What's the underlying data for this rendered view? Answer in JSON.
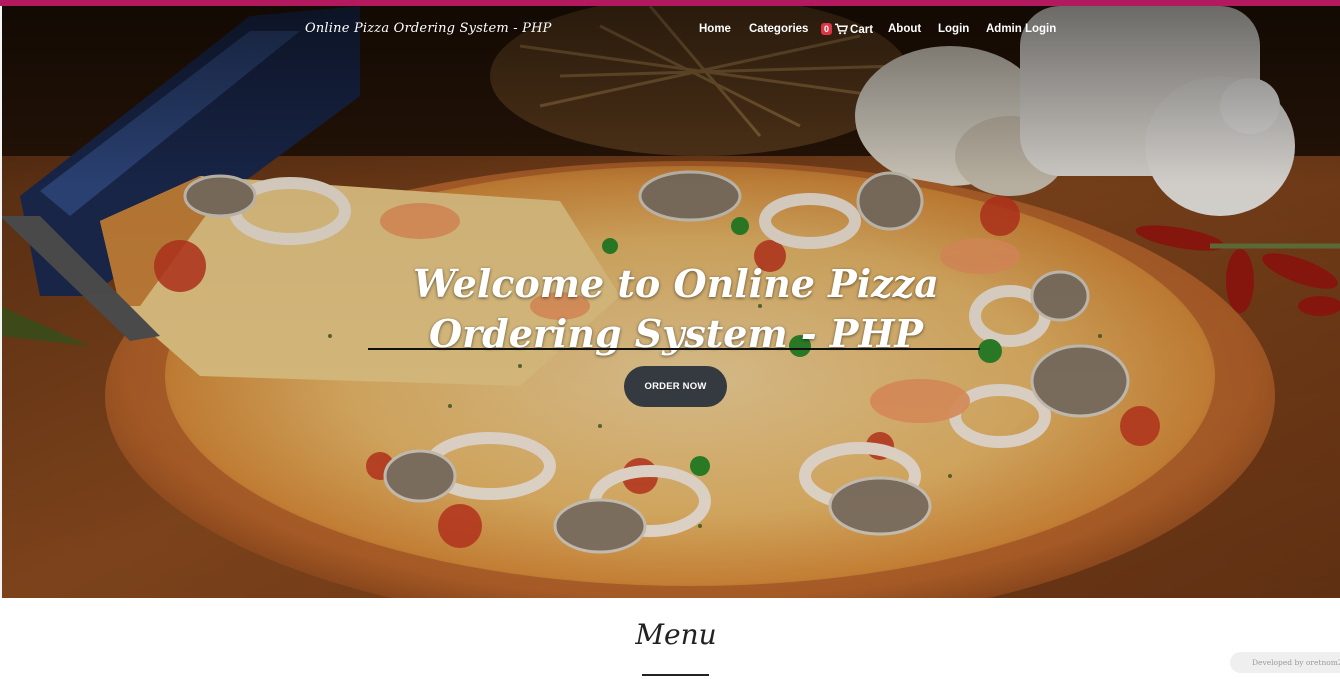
{
  "brand": {
    "name": "Online Pizza Ordering System - PHP"
  },
  "nav": {
    "items": [
      {
        "key": "home",
        "label": "Home"
      },
      {
        "key": "categories",
        "label": "Categories"
      },
      {
        "key": "about",
        "label": "About"
      },
      {
        "key": "login",
        "label": "Login"
      },
      {
        "key": "admin_login",
        "label": "Admin Login"
      }
    ],
    "cart": {
      "count": "0",
      "label": "Cart",
      "icon": "cart-icon"
    }
  },
  "hero": {
    "title": "Welcome to Online Pizza Ordering System - PHP",
    "button_label": "ORDER NOW"
  },
  "menu_section": {
    "title": "Menu"
  },
  "footer": {
    "developed_by": "Developed by oretnom23"
  },
  "colors": {
    "accent_strip": "#b3195f",
    "button_bg": "#343a40",
    "badge": "#dc3545"
  }
}
